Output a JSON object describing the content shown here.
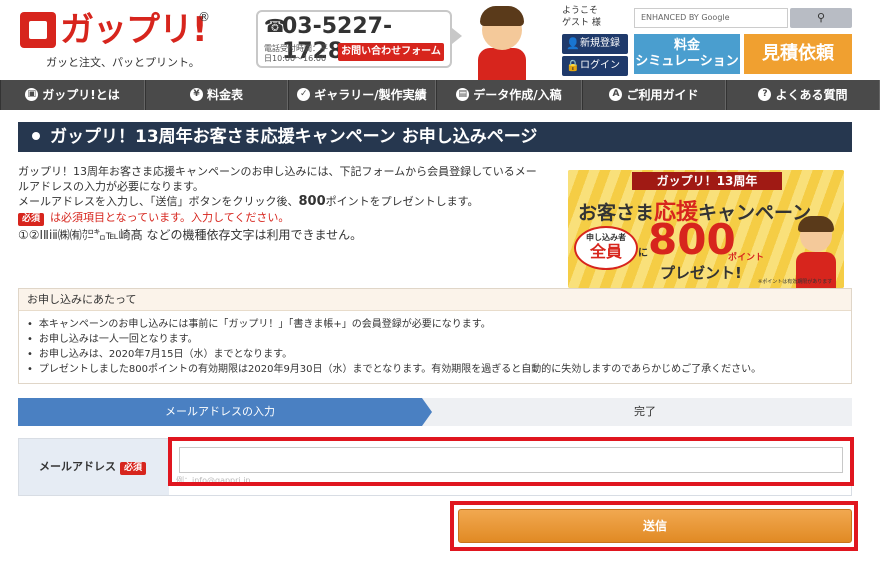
{
  "header": {
    "logo_text": "ガップリ!",
    "logo_reg": "®",
    "tagline": "ガッと注文、パッとプリント。",
    "phone": "03-5227-1728",
    "phone_hours": "電話受付時間：平日10:00〜16:00",
    "contact_btn": "お問い合わせフォーム",
    "welcome_line1": "ようこそ",
    "welcome_line2": "ゲスト 様",
    "register_btn": "新規登録",
    "login_btn": "ログイン",
    "search_placeholder": "ENHANCED BY Google",
    "search_icon": "search-icon",
    "price_btn_line1": "料金",
    "price_btn_line2": "シミュレーション",
    "quote_btn": "見積依頼"
  },
  "nav": {
    "items": [
      {
        "label": "ガップリ!とは",
        "icon": "▣"
      },
      {
        "label": "料金表",
        "icon": "¥"
      },
      {
        "label": "ギャラリー/製作実績",
        "icon": "✓"
      },
      {
        "label": "データ作成/入稿",
        "icon": "▤"
      },
      {
        "label": "ご利用ガイド",
        "icon": "A"
      },
      {
        "label": "よくある質問",
        "icon": "?"
      }
    ]
  },
  "page": {
    "title": "ガップリ！13周年お客さま応援キャンペーン お申し込みページ",
    "intro_1": "ガップリ！13周年お客さま応援キャンペーンのお申し込みには、下記フォームから会員登録しているメー",
    "intro_2": "ルアドレスの入力が必要になります。",
    "intro_3a": "メールアドレスを入力し、「送信」ボタンをクリック後、",
    "intro_3b": "800",
    "intro_3c": "ポイントをプレゼントします。",
    "required_badge": "必須",
    "required_note": "は必須項目となっています。入力してください。",
    "dependent_chars": "①②ⅠⅡⅰⅱ㈱㈲㌍㌔℡崎髙 などの機種依存文字は利用できません。"
  },
  "banner": {
    "ribbon": "ガップリ！13周年",
    "line1a": "お客さま",
    "line1b": "応援",
    "line1c": "キャンペーン",
    "circle_top": "申し込み者",
    "circle_big": "全員",
    "circle_ni": "に",
    "amount": "800",
    "point": "ポイント",
    "present": "プレゼント!",
    "note": "※ポイントは有効期限があります"
  },
  "notice": {
    "heading": "お申し込みにあたって",
    "items": [
      "本キャンペーンのお申し込みには事前に「ガップリ！」「書きま帳+」の会員登録が必要になります。",
      "お申し込みは一人一回となります。",
      "お申し込みは、2020年7月15日（水）までとなります。",
      "プレゼントしました800ポイントの有効期限は2020年9月30日（水）までとなります。有効期限を過ぎると自動的に失効しますのであらかじめご了承ください。"
    ]
  },
  "steps": {
    "step1": "メールアドレスの入力",
    "step2": "完了"
  },
  "form": {
    "email_label": "メールアドレス",
    "email_value": "",
    "email_hint": "例：info@gappri.jp",
    "submit_label": "送信"
  }
}
